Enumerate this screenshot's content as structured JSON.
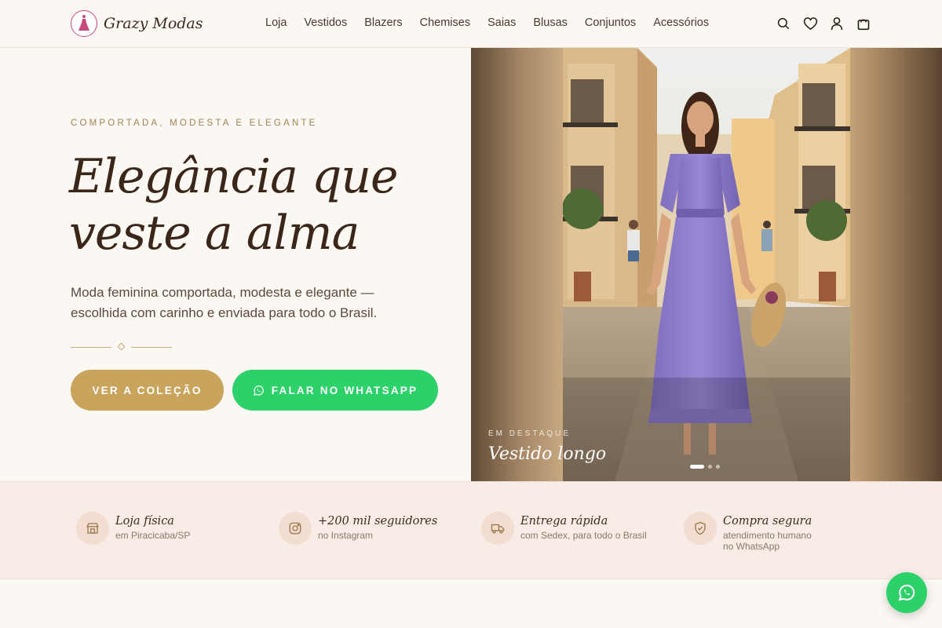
{
  "brand": {
    "name": "Grazy Modas",
    "logo_icon": "dress-logo-icon"
  },
  "nav": {
    "items": [
      {
        "label": "Loja"
      },
      {
        "label": "Vestidos"
      },
      {
        "label": "Blazers"
      },
      {
        "label": "Chemises"
      },
      {
        "label": "Saias"
      },
      {
        "label": "Blusas"
      },
      {
        "label": "Conjuntos"
      },
      {
        "label": "Acessórios"
      }
    ],
    "icons": [
      "search-icon",
      "heart-icon",
      "user-icon",
      "cart-icon"
    ]
  },
  "hero": {
    "eyebrow": "COMPORTADA, MODESTA E ELEGANTE",
    "headline_line1": "Elegância que",
    "headline_line2": "veste a alma",
    "subtitle": "Moda feminina comportada, modesta e elegante — escolhida com carinho e enviada para todo o Brasil.",
    "primary_button": "VER A COLEÇÃO",
    "whatsapp_button": "FALAR NO WHATSAPP"
  },
  "carousel": {
    "eyebrow": "EM DESTAQUE",
    "title": "Vestido longo",
    "slide_count": 3,
    "active_slide": 1
  },
  "features": [
    {
      "icon": "store-icon",
      "title": "Loja física",
      "subtitle": "em Piracicaba/SP"
    },
    {
      "icon": "instagram-icon",
      "title": "+200 mil seguidores",
      "subtitle": "no Instagram"
    },
    {
      "icon": "truck-icon",
      "title": "Entrega rápida",
      "subtitle": "com Sedex, para todo o Brasil"
    },
    {
      "icon": "shield-check-icon",
      "title": "Compra segura",
      "subtitle": "atendimento humano no WhatsApp"
    }
  ],
  "colors": {
    "gold": "#c8a45c",
    "whatsapp_green": "#2dd16a",
    "background": "#fbf7f2",
    "text_dark": "#3a271a"
  }
}
